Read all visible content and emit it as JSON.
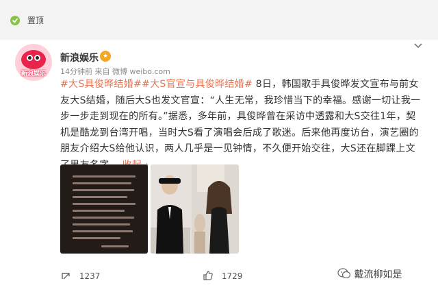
{
  "pin": {
    "label": "置顶"
  },
  "post": {
    "author": "新浪娱乐",
    "badge": "★",
    "avatar_text": "新浪娱乐",
    "meta": "14分钟前  来自 微博 weibo.com",
    "tag1": "#大S具俊晔结婚#",
    "tag2": "#大S官宣与具俊晔结婚#",
    "text": " 8日，韩国歌手具俊晔发文宣布与前女友大S结婚，随后大S也发文官宣：“人生无常，我珍惜当下的幸福。感谢一切让我一步一步走到现在的所有。”据悉，多年前，具俊晔曾在采访中透露和大S交往1年，契机是酷龙到台湾开唱，当时大S看了演唱会后成了歌迷。后来他再度访台，演艺圈的朋友介绍大S给他认识，两人几乎是一见钟情，不久便开始交往，大S还在脚踝上文了男友名字。",
    "collapse": "收起"
  },
  "photos": [
    {
      "name": "note-screenshot"
    },
    {
      "name": "couple-photo"
    }
  ],
  "actions": {
    "repost": "1237",
    "like": "1729"
  },
  "watermark": "戴流柳如是",
  "colors": {
    "link": "#eb7350",
    "background": "#f3f3f3",
    "card": "#ffffff"
  }
}
